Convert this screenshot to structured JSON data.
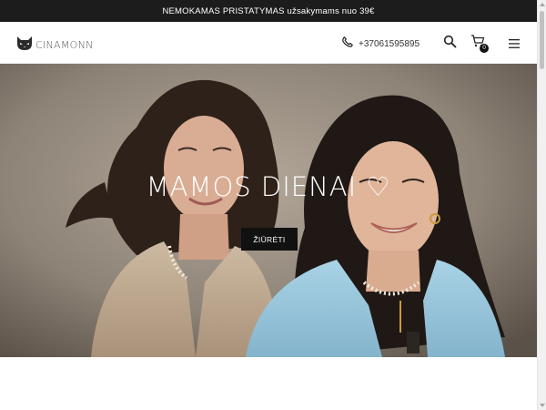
{
  "announcement": {
    "text": "NEMOKAMAS PRISTATYMAS užsakymams nuo 39€"
  },
  "header": {
    "logo_text": "CINAMONN",
    "phone": "+37061595895",
    "cart_count": "0"
  },
  "hero": {
    "title": "MAMOS DIENAI ♡",
    "button_label": "ŽIŪRĖTI"
  },
  "icons": {
    "logo": "cat-logo-icon",
    "phone": "phone-icon",
    "search": "search-icon",
    "cart": "cart-icon",
    "menu": "hamburger-menu-icon"
  },
  "colors": {
    "announcement_bg": "#1c1c1c",
    "button_bg": "#111111",
    "text_on_dark": "#ffffff"
  }
}
